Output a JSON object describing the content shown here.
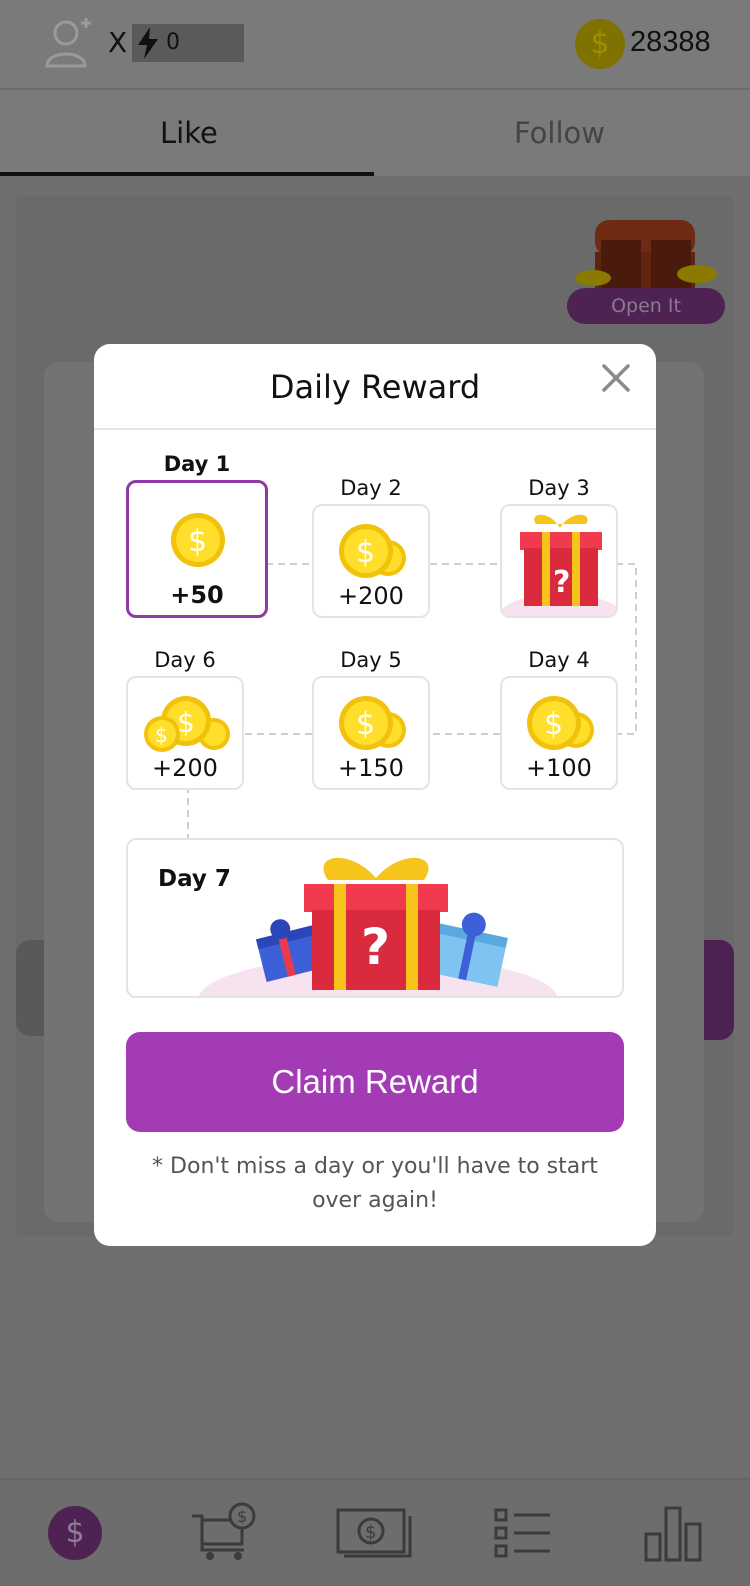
{
  "header": {
    "x_label": "X",
    "energy_value": "0",
    "coin_balance": "28388",
    "coin_symbol": "$"
  },
  "tabs": [
    {
      "label": "Like",
      "active": true
    },
    {
      "label": "Follow",
      "active": false
    }
  ],
  "chest": {
    "button_label": "Open It"
  },
  "modal": {
    "title": "Daily Reward",
    "days": [
      {
        "label": "Day 1",
        "amount": "+50",
        "state": "current"
      },
      {
        "label": "Day 2",
        "amount": "+200"
      },
      {
        "label": "Day 3",
        "amount": "?"
      },
      {
        "label": "Day 4",
        "amount": "+100"
      },
      {
        "label": "Day 5",
        "amount": "+150"
      },
      {
        "label": "Day 6",
        "amount": "+200"
      },
      {
        "label": "Day 7",
        "amount": "?"
      }
    ],
    "claim_label": "Claim Reward",
    "note": "* Don't miss a day or you'll have to start over again!"
  },
  "bottom_nav": {
    "items": [
      "dollar-icon",
      "cart-icon",
      "cash-icon",
      "list-icon",
      "chart-icon"
    ]
  },
  "colors": {
    "accent": "#a33bb4",
    "active_border": "#8e3aa4",
    "coin": "#f6d21c",
    "gift_red": "#e32b3f"
  }
}
